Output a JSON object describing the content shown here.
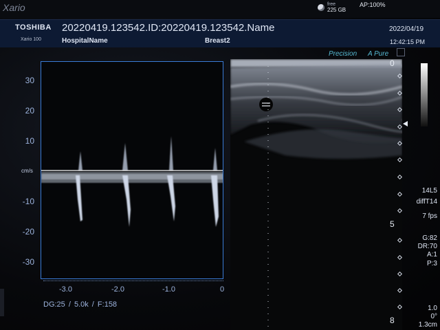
{
  "topbar": {
    "brand": "Xario",
    "disk_label": "free",
    "disk_size": "225 GB",
    "ap_status": "AP:100%"
  },
  "header": {
    "manufacturer": "TOSHIBA",
    "model": "Xario 100",
    "patient_id": "20220419.123542.ID:20220419.123542.Name",
    "hospital": "HospitalName",
    "preset": "Breast2",
    "date": "2022/04/19",
    "time": "12:42:15 PM"
  },
  "spectrum": {
    "y_ticks": [
      "30",
      "20",
      "10",
      "-10",
      "-20",
      "-30"
    ],
    "y_unit": "cm/s",
    "x_ticks": [
      "-3.0",
      "-2.0",
      "-1.0",
      "0"
    ],
    "doppler_settings": "DG:25  / 5.0k   / F:158"
  },
  "bmode": {
    "precision_label": "Precision",
    "apure_label": "A Pure",
    "depth_top": "0",
    "depth_mid": "5",
    "depth_bottom": "8"
  },
  "params": {
    "probe": "14L5",
    "mode": "diffT14",
    "fps": "7 fps",
    "gain": "G:82",
    "dynamic_range": "DR:70",
    "a": "A:1",
    "p": "P:3",
    "angle_value": "1.0",
    "angle": "0°",
    "cm": "1.3cm"
  }
}
